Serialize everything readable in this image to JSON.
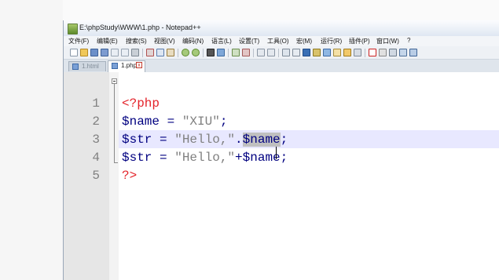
{
  "window": {
    "title": "E:\\phpStudy\\WWW\\1.php - Notepad++"
  },
  "menu": [
    "文件(F)",
    "编辑(E)",
    "搜索(S)",
    "视图(V)",
    "编码(N)",
    "语言(L)",
    "设置(T)",
    "工具(O)",
    "宏(M)",
    "运行(R)",
    "插件(P)",
    "窗口(W)",
    "?"
  ],
  "tabs": [
    {
      "label": "1.html"
    },
    {
      "label": "1.php"
    }
  ],
  "editor": {
    "line_numbers": [
      "1",
      "2",
      "3",
      "4",
      "5"
    ],
    "lines": [
      {
        "open_tag": "<?php"
      },
      {
        "var": "$name",
        "eq": " = ",
        "str": "\"XIU\"",
        "end": ";"
      },
      {
        "var": "$str",
        "eq": " = ",
        "str": "\"Hello,\"",
        "dot": ".",
        "sel": "$name",
        "end": ";"
      },
      {
        "var": "$str",
        "eq": " = ",
        "str": "\"Hello,\"",
        "plus": "+",
        "var2": "$name",
        "end": ";"
      },
      {
        "close_tag": "?>"
      }
    ]
  },
  "colors": {
    "php_tag": "#e4232a",
    "variable": "#000080",
    "string": "#808080",
    "current_line": "#e8e8ff",
    "selection": "#c0c0c0"
  },
  "icons": [
    "new-file-icon",
    "open-icon",
    "save-icon",
    "save-all-icon",
    "close-icon",
    "close-all-icon",
    "print-icon",
    "cut-icon",
    "copy-icon",
    "paste-icon",
    "undo-icon",
    "redo-icon",
    "find-icon",
    "replace-icon",
    "zoom-in-icon",
    "zoom-out-icon",
    "sync-v-icon",
    "sync-h-icon",
    "wrap-icon",
    "show-all-icon",
    "indent-guide-icon",
    "user-lang-icon",
    "doc-map-icon",
    "function-list-icon",
    "folder-workspace-icon",
    "monitor-icon",
    "record-icon",
    "stop-icon",
    "play-icon",
    "play-multi-icon",
    "save-macro-icon"
  ]
}
